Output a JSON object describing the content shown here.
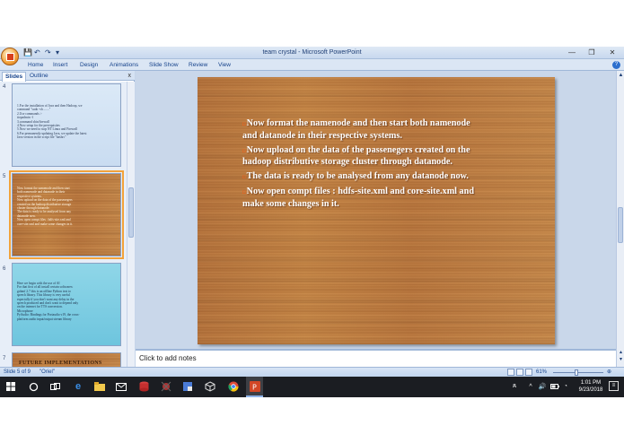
{
  "app": {
    "title": "team crystal - Microsoft PowerPoint",
    "qat": [
      "💾",
      "↶",
      "↷",
      "▾"
    ],
    "window_controls": [
      "—",
      "❐",
      "✕"
    ],
    "ribbon_tabs": [
      "Home",
      "Insert",
      "Design",
      "Animations",
      "Slide Show",
      "Review",
      "View"
    ]
  },
  "pane": {
    "tabs": [
      "Slides",
      "Outline"
    ],
    "close": "x",
    "slides": [
      {
        "number": "4",
        "theme": "ice",
        "lines": [
          "1.For the installation of Java and then Hadoop, we",
          "command \"sudo -sh .......\"",
          "2.Use commands >",
          "ttopadmin -f",
          "3.command sbin/firewall",
          "4.Now setup for the prerequisites",
          "5.Now we need to stop NT Linux and Firewall",
          "6.For permanently updating Java, we update the latest",
          "Java version in the script file \"bashrc\""
        ]
      },
      {
        "number": "5",
        "theme": "wood",
        "selected": true,
        "lines": [
          "Now format the namenode and then start",
          "both namenode and datanode in their",
          "respective systems.",
          "Now upload on the data of the passenegers",
          "created on the hadoop distributive storage",
          "cluster through datanode.",
          "The data is ready to be analysed from any",
          "datanode now.",
          "Now open compt files : hdfs-site.xml and",
          "core-site.xml and make some changes in it."
        ]
      },
      {
        "number": "6",
        "theme": "aqua",
        "lines": [
          "Here we begin with the use of AI",
          "For that first of all install certain softwares:",
          "gobmf 2.7 this is an offline Python text to",
          "speech library. This library is very useful",
          "especially if you don't want any delay in the",
          "speech produced and don't want to depend only",
          "on the internet for TTS conversion.",
          "Microphone",
          "PyAudio: Bindings for Portaudio v19, the cross-",
          "platform audio input/output stream library"
        ]
      },
      {
        "number": "7",
        "theme": "wood",
        "lines": [
          "FUTURE IMPLEMENTATIONS"
        ]
      }
    ]
  },
  "slide": {
    "bullet": "◘",
    "paragraphs": [
      "Now format the namenode and then start both namenode and datanode in their respective systems.",
      "Now upload on the data of the passenegers created  on the hadoop distributive storage cluster through datanode.",
      "The data is ready to be analysed from any datanode now.",
      "Now open compt files : hdfs-site.xml and core-site.xml  and make some changes in it."
    ]
  },
  "notes": {
    "placeholder": "Click to add notes"
  },
  "status": {
    "slide_info": "Slide 5 of 9",
    "theme": "\"Oriel\"",
    "zoom": "61%"
  },
  "taskbar": {
    "time": "1:01 PM",
    "date": "9/23/2018",
    "icons": [
      "windows-start-icon",
      "search-icon",
      "task-view-icon",
      "edge-icon",
      "file-explorer-icon",
      "mail-icon",
      "database-icon",
      "misc-app-icon",
      "puzzle-icon",
      "cube-icon",
      "chrome-icon",
      "powerpoint-icon"
    ]
  },
  "colors": {
    "accent": "#f2a23a",
    "bullet": "#e9631e",
    "ribbon_text": "#15428b",
    "taskbar": "#1b1d22"
  }
}
